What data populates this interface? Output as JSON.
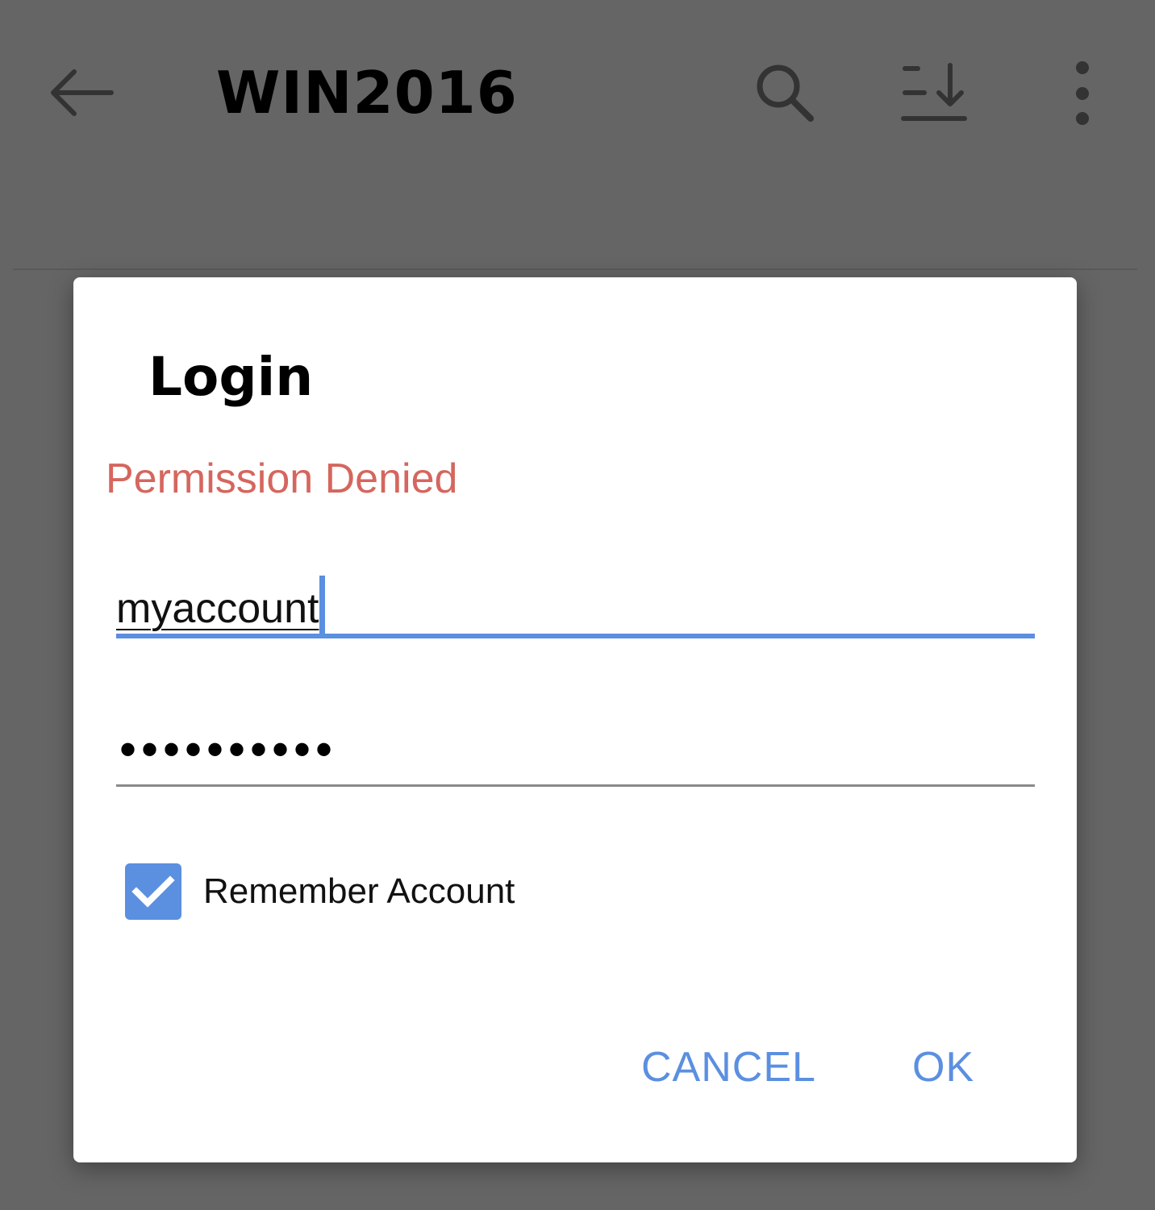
{
  "appbar": {
    "title": "WIN2016",
    "back_icon": "arrow-left-icon",
    "search_icon": "search-icon",
    "sort_icon": "sort-download-icon",
    "more_icon": "more-vertical-icon"
  },
  "dialog": {
    "title": "Login",
    "error": "Permission Denied",
    "username": "myaccount",
    "password_mask": "••••••••••",
    "remember_label": "Remember Account",
    "remember_checked": true,
    "cancel_label": "CANCEL",
    "ok_label": "OK"
  },
  "colors": {
    "accent": "#5b8fe0",
    "error": "#d5665e",
    "scrim_background": "#656565",
    "dialog_background": "#ffffff"
  }
}
